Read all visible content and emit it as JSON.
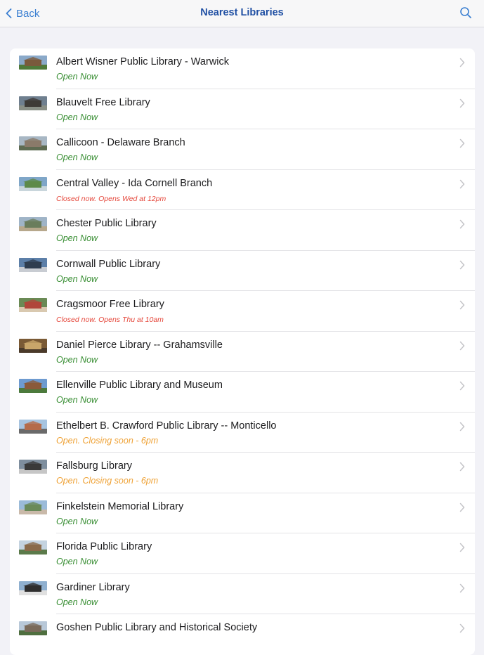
{
  "nav": {
    "back_label": "Back",
    "title": "Nearest Libraries",
    "search_icon": "search-icon"
  },
  "colors": {
    "open": "#3a8f35",
    "closed": "#e5483c",
    "soon": "#efa236",
    "accent": "#3b7fd1"
  },
  "libraries": [
    {
      "name": "Albert Wisner Public Library - Warwick",
      "status": "Open Now",
      "state": "open"
    },
    {
      "name": "Blauvelt Free Library",
      "status": "Open Now",
      "state": "open"
    },
    {
      "name": "Callicoon - Delaware Branch",
      "status": "Open Now",
      "state": "open"
    },
    {
      "name": "Central Valley - Ida Cornell Branch",
      "status": "Closed now. Opens Wed at 12pm",
      "state": "closed"
    },
    {
      "name": "Chester Public Library",
      "status": "Open Now",
      "state": "open"
    },
    {
      "name": "Cornwall Public Library",
      "status": "Open Now",
      "state": "open"
    },
    {
      "name": "Cragsmoor Free Library",
      "status": "Closed now. Opens Thu at 10am",
      "state": "closed"
    },
    {
      "name": "Daniel Pierce Library -- Grahamsville",
      "status": "Open Now",
      "state": "open"
    },
    {
      "name": "Ellenville Public Library and Museum",
      "status": "Open Now",
      "state": "open"
    },
    {
      "name": "Ethelbert B. Crawford Public Library -- Monticello",
      "status": "Open. Closing soon - 6pm",
      "state": "soon"
    },
    {
      "name": "Fallsburg Library",
      "status": "Open. Closing soon - 6pm",
      "state": "soon"
    },
    {
      "name": "Finkelstein Memorial Library",
      "status": "Open Now",
      "state": "open"
    },
    {
      "name": "Florida Public Library",
      "status": "Open Now",
      "state": "open"
    },
    {
      "name": "Gardiner Library",
      "status": "Open Now",
      "state": "open"
    },
    {
      "name": "Goshen Public Library and Historical Society",
      "status": "",
      "state": "open"
    }
  ]
}
